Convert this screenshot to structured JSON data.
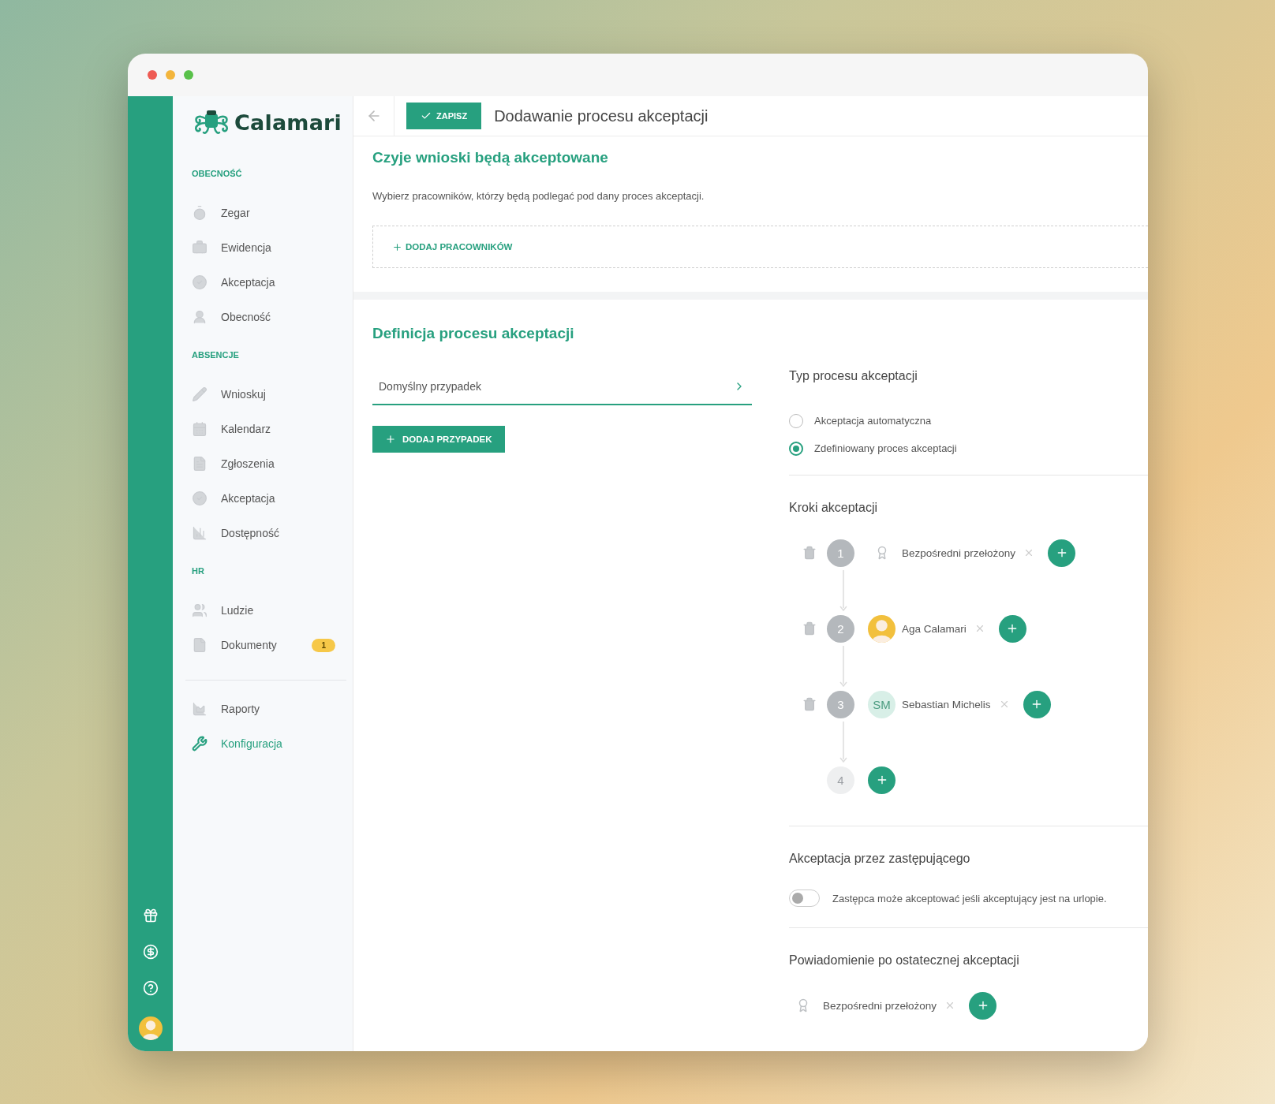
{
  "logo": {
    "text": "Calamari"
  },
  "sidebar": {
    "sections": [
      {
        "heading": "OBECNOŚĆ",
        "items": [
          {
            "label": "Zegar",
            "selected": false
          },
          {
            "label": "Ewidencja",
            "selected": false
          },
          {
            "label": "Akceptacja",
            "selected": false
          },
          {
            "label": "Obecność",
            "selected": false
          }
        ]
      },
      {
        "heading": "ABSENCJE",
        "items": [
          {
            "label": "Wnioskuj",
            "selected": false
          },
          {
            "label": "Kalendarz",
            "selected": false
          },
          {
            "label": "Zgłoszenia",
            "selected": false
          },
          {
            "label": "Akceptacja",
            "selected": false
          },
          {
            "label": "Dostępność",
            "selected": false
          }
        ]
      },
      {
        "heading": "HR",
        "items": [
          {
            "label": "Ludzie",
            "selected": false
          },
          {
            "label": "Dokumenty",
            "selected": false,
            "badge": "1"
          }
        ]
      },
      {
        "items": [
          {
            "label": "Raporty",
            "selected": false
          },
          {
            "label": "Konfiguracja",
            "selected": true
          }
        ]
      }
    ]
  },
  "header": {
    "save_button": "ZAPISZ",
    "title": "Dodawanie procesu akceptacji"
  },
  "employees_section": {
    "title": "Czyje wnioski będą akceptowane",
    "description": "Wybierz pracowników, którzy będą podlegać pod dany proces akceptacji.",
    "add_button": "DODAJ PRACOWNIKÓW"
  },
  "definition_section": {
    "title": "Definicja procesu akceptacji",
    "case_field": "Domyślny przypadek",
    "add_case_button": "DODAJ PRZYPADEK",
    "process_type": {
      "title": "Typ procesu akceptacji",
      "options": [
        {
          "label": "Akceptacja automatyczna",
          "selected": false
        },
        {
          "label": "Zdefiniowany proces akceptacji",
          "selected": true
        }
      ]
    },
    "steps": {
      "title": "Kroki akceptacji",
      "items": [
        {
          "number": "1",
          "disabled": false,
          "approvers": [
            {
              "kind": "role",
              "name": "Bezpośredni przełożony"
            }
          ]
        },
        {
          "number": "2",
          "disabled": false,
          "approvers": [
            {
              "kind": "avatar",
              "name": "Aga Calamari"
            }
          ]
        },
        {
          "number": "3",
          "disabled": false,
          "approvers": [
            {
              "kind": "initials",
              "initials": "SM",
              "name": "Sebastian Michelis"
            }
          ]
        },
        {
          "number": "4",
          "disabled": true
        }
      ]
    },
    "substitute": {
      "title": "Akceptacja przez zastępującego",
      "toggle_label": "Zastępca może akceptować jeśli akceptujący jest na urlopie.",
      "on": false
    },
    "notification": {
      "title": "Powiadomienie po ostatecznej akceptacji",
      "approvers": [
        {
          "kind": "role",
          "name": "Bezpośredni przełożony"
        }
      ]
    }
  }
}
